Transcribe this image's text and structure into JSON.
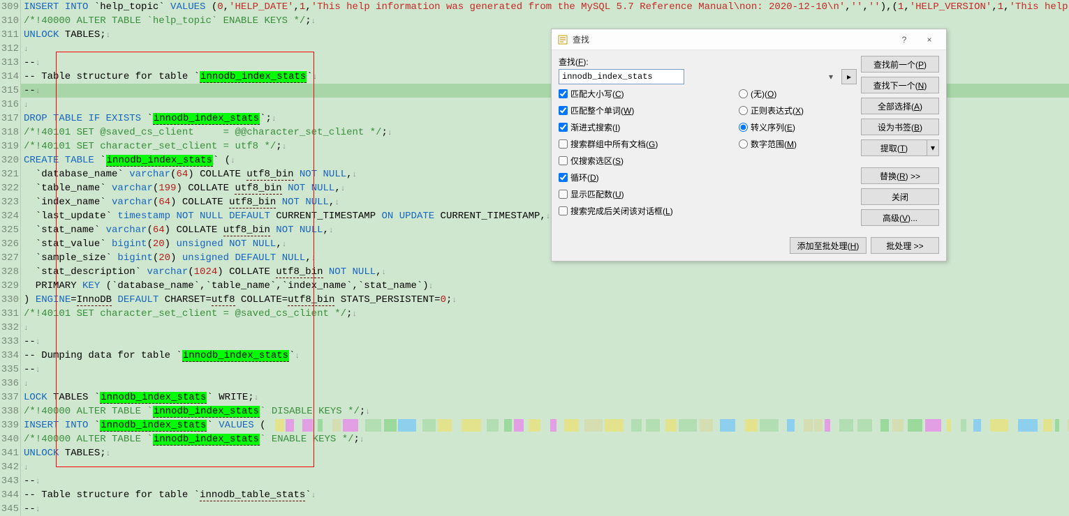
{
  "editor": {
    "highlight_token": "innodb_index_stats",
    "lines": [
      {
        "n": 309,
        "seg": [
          [
            "kw",
            "INSERT "
          ],
          [
            "kw",
            "INTO "
          ],
          [
            "txt",
            "`help_topic` "
          ],
          [
            "kw",
            "VALUES "
          ],
          [
            "txt",
            "("
          ],
          [
            "num",
            "0"
          ],
          [
            "txt",
            ","
          ],
          [
            "st",
            "'HELP_DATE'"
          ],
          [
            "txt",
            ","
          ],
          [
            "num",
            "1"
          ],
          [
            "txt",
            ","
          ],
          [
            "st",
            "'This help information was generated from the MySQL 5.7 Reference Manual\\non: 2020-12-10\\n'"
          ],
          [
            "txt",
            ","
          ],
          [
            "st",
            "''"
          ],
          [
            "txt",
            ","
          ],
          [
            "st",
            "''"
          ],
          [
            "txt",
            "),("
          ],
          [
            "num",
            "1"
          ],
          [
            "txt",
            ","
          ],
          [
            "st",
            "'HELP_VERSION'"
          ],
          [
            "txt",
            ","
          ],
          [
            "num",
            "1"
          ],
          [
            "txt",
            ","
          ],
          [
            "st",
            "'This help"
          ]
        ]
      },
      {
        "n": 310,
        "seg": [
          [
            "cm",
            "/*!40000 ALTER TABLE `help_topic` ENABLE KEYS */"
          ],
          [
            "txt",
            ";"
          ],
          [
            "nl",
            "↓"
          ]
        ]
      },
      {
        "n": 311,
        "seg": [
          [
            "kw",
            "UNLOCK "
          ],
          [
            "txt",
            "TABLES;"
          ],
          [
            "nl",
            "↓"
          ]
        ]
      },
      {
        "n": 312,
        "seg": [
          [
            "nl",
            "↓"
          ]
        ]
      },
      {
        "n": 313,
        "seg": [
          [
            "txt",
            "--"
          ],
          [
            "nl",
            "↓"
          ]
        ]
      },
      {
        "n": 314,
        "seg": [
          [
            "txt",
            "-- Table structure for table `"
          ],
          [
            "hl",
            "innodb_index_stats"
          ],
          [
            "txt",
            "`"
          ],
          [
            "nl",
            "↓"
          ]
        ]
      },
      {
        "n": 315,
        "current": true,
        "seg": [
          [
            "txt",
            "--"
          ],
          [
            "nl",
            "↓"
          ]
        ]
      },
      {
        "n": 316,
        "seg": [
          [
            "nl",
            "↓"
          ]
        ]
      },
      {
        "n": 317,
        "seg": [
          [
            "kw",
            "DROP "
          ],
          [
            "kw",
            "TABLE "
          ],
          [
            "kw",
            "IF "
          ],
          [
            "kw",
            "EXISTS "
          ],
          [
            "txt",
            "`"
          ],
          [
            "hl",
            "innodb_index_stats"
          ],
          [
            "txt",
            "`;"
          ],
          [
            "nl",
            "↓"
          ]
        ]
      },
      {
        "n": 318,
        "seg": [
          [
            "cm",
            "/*!40101 SET @saved_cs_client     = @@character_set_client */"
          ],
          [
            "txt",
            ";"
          ],
          [
            "nl",
            "↓"
          ]
        ]
      },
      {
        "n": 319,
        "seg": [
          [
            "cm",
            "/*!40101 SET character_set_client = "
          ],
          [
            "cm",
            "utf8"
          ],
          [
            "cm",
            " */"
          ],
          [
            "txt",
            ";"
          ],
          [
            "nl",
            "↓"
          ]
        ]
      },
      {
        "n": 320,
        "seg": [
          [
            "kw",
            "CREATE "
          ],
          [
            "kw",
            "TABLE "
          ],
          [
            "txt",
            "`"
          ],
          [
            "hl",
            "innodb_index_stats"
          ],
          [
            "txt",
            "` ("
          ],
          [
            "nl",
            "↓"
          ]
        ]
      },
      {
        "n": 321,
        "seg": [
          [
            "txt",
            "  `database_name` "
          ],
          [
            "kw",
            "varchar"
          ],
          [
            "txt",
            "("
          ],
          [
            "num",
            "64"
          ],
          [
            "txt",
            ") COLLATE "
          ],
          [
            "ul",
            "utf8_bin"
          ],
          [
            "txt",
            " "
          ],
          [
            "kw",
            "NOT "
          ],
          [
            "kw",
            "NULL"
          ],
          [
            "txt",
            ","
          ],
          [
            "nl",
            "↓"
          ]
        ]
      },
      {
        "n": 322,
        "seg": [
          [
            "txt",
            "  `table_name` "
          ],
          [
            "kw",
            "varchar"
          ],
          [
            "txt",
            "("
          ],
          [
            "num",
            "199"
          ],
          [
            "txt",
            ") COLLATE "
          ],
          [
            "ul",
            "utf8_bin"
          ],
          [
            "txt",
            " "
          ],
          [
            "kw",
            "NOT "
          ],
          [
            "kw",
            "NULL"
          ],
          [
            "txt",
            ","
          ],
          [
            "nl",
            "↓"
          ]
        ]
      },
      {
        "n": 323,
        "seg": [
          [
            "txt",
            "  `index_name` "
          ],
          [
            "kw",
            "varchar"
          ],
          [
            "txt",
            "("
          ],
          [
            "num",
            "64"
          ],
          [
            "txt",
            ") COLLATE "
          ],
          [
            "ul",
            "utf8_bin"
          ],
          [
            "txt",
            " "
          ],
          [
            "kw",
            "NOT "
          ],
          [
            "kw",
            "NULL"
          ],
          [
            "txt",
            ","
          ],
          [
            "nl",
            "↓"
          ]
        ]
      },
      {
        "n": 324,
        "seg": [
          [
            "txt",
            "  `last_update` "
          ],
          [
            "kw",
            "timestamp "
          ],
          [
            "kw",
            "NOT "
          ],
          [
            "kw",
            "NULL "
          ],
          [
            "kw",
            "DEFAULT "
          ],
          [
            "txt",
            "CURRENT_TIMESTAMP "
          ],
          [
            "kw",
            "ON "
          ],
          [
            "kw",
            "UPDATE "
          ],
          [
            "txt",
            "CURRENT_TIMESTAMP,"
          ],
          [
            "nl",
            "↓"
          ]
        ]
      },
      {
        "n": 325,
        "seg": [
          [
            "txt",
            "  `stat_name` "
          ],
          [
            "kw",
            "varchar"
          ],
          [
            "txt",
            "("
          ],
          [
            "num",
            "64"
          ],
          [
            "txt",
            ") COLLATE "
          ],
          [
            "ul",
            "utf8_bin"
          ],
          [
            "txt",
            " "
          ],
          [
            "kw",
            "NOT "
          ],
          [
            "kw",
            "NULL"
          ],
          [
            "txt",
            ","
          ],
          [
            "nl",
            "↓"
          ]
        ]
      },
      {
        "n": 326,
        "seg": [
          [
            "txt",
            "  `stat_value` "
          ],
          [
            "kw",
            "bigint"
          ],
          [
            "txt",
            "("
          ],
          [
            "num",
            "20"
          ],
          [
            "txt",
            ") "
          ],
          [
            "kw",
            "unsigned "
          ],
          [
            "kw",
            "NOT "
          ],
          [
            "kw",
            "NULL"
          ],
          [
            "txt",
            ","
          ],
          [
            "nl",
            "↓"
          ]
        ]
      },
      {
        "n": 327,
        "seg": [
          [
            "txt",
            "  `sample_size` "
          ],
          [
            "kw",
            "bigint"
          ],
          [
            "txt",
            "("
          ],
          [
            "num",
            "20"
          ],
          [
            "txt",
            ") "
          ],
          [
            "kw",
            "unsigned "
          ],
          [
            "kw",
            "DEFAULT "
          ],
          [
            "kw",
            "NULL"
          ],
          [
            "txt",
            ","
          ],
          [
            "nl",
            "↓"
          ]
        ]
      },
      {
        "n": 328,
        "seg": [
          [
            "txt",
            "  `stat_description` "
          ],
          [
            "kw",
            "varchar"
          ],
          [
            "txt",
            "("
          ],
          [
            "num",
            "1024"
          ],
          [
            "txt",
            ") COLLATE "
          ],
          [
            "ul",
            "utf8_bin"
          ],
          [
            "txt",
            " "
          ],
          [
            "kw",
            "NOT "
          ],
          [
            "kw",
            "NULL"
          ],
          [
            "txt",
            ","
          ],
          [
            "nl",
            "↓"
          ]
        ]
      },
      {
        "n": 329,
        "seg": [
          [
            "txt",
            "  PRIMARY "
          ],
          [
            "kw",
            "KEY "
          ],
          [
            "txt",
            "(`database_name`,`table_name`,`index_name`,`stat_name`)"
          ],
          [
            "nl",
            "↓"
          ]
        ]
      },
      {
        "n": 330,
        "seg": [
          [
            "txt",
            ") "
          ],
          [
            "kw",
            "ENGINE"
          ],
          [
            "txt",
            "="
          ],
          [
            "ul",
            "InnoDB"
          ],
          [
            "txt",
            " "
          ],
          [
            "kw",
            "DEFAULT "
          ],
          [
            "txt",
            "CHARSET="
          ],
          [
            "ul",
            "utf8"
          ],
          [
            "txt",
            " COLLATE="
          ],
          [
            "ul",
            "utf8_bin"
          ],
          [
            "txt",
            " STATS_PERSISTENT="
          ],
          [
            "num",
            "0"
          ],
          [
            "txt",
            ";"
          ],
          [
            "nl",
            "↓"
          ]
        ]
      },
      {
        "n": 331,
        "seg": [
          [
            "cm",
            "/*!40101 SET character_set_client = @saved_cs_client */"
          ],
          [
            "txt",
            ";"
          ],
          [
            "nl",
            "↓"
          ]
        ]
      },
      {
        "n": 332,
        "seg": [
          [
            "nl",
            "↓"
          ]
        ]
      },
      {
        "n": 333,
        "seg": [
          [
            "txt",
            "--"
          ],
          [
            "nl",
            "↓"
          ]
        ]
      },
      {
        "n": 334,
        "seg": [
          [
            "txt",
            "-- Dumping data for table `"
          ],
          [
            "hl",
            "innodb_index_stats"
          ],
          [
            "txt",
            "`"
          ],
          [
            "nl",
            "↓"
          ]
        ]
      },
      {
        "n": 335,
        "seg": [
          [
            "txt",
            "--"
          ],
          [
            "nl",
            "↓"
          ]
        ]
      },
      {
        "n": 336,
        "seg": [
          [
            "nl",
            "↓"
          ]
        ]
      },
      {
        "n": 337,
        "seg": [
          [
            "kw",
            "LOCK "
          ],
          [
            "txt",
            "TABLES `"
          ],
          [
            "hl",
            "innodb_index_stats"
          ],
          [
            "txt",
            "` WRITE;"
          ],
          [
            "nl",
            "↓"
          ]
        ]
      },
      {
        "n": 338,
        "seg": [
          [
            "cm",
            "/*!40000 ALTER TABLE `"
          ],
          [
            "hl",
            "innodb_index_stats"
          ],
          [
            "cm",
            "` DISABLE KEYS */"
          ],
          [
            "txt",
            ";"
          ],
          [
            "nl",
            "↓"
          ]
        ]
      },
      {
        "n": 339,
        "seg": [
          [
            "kw",
            "INSERT "
          ],
          [
            "kw",
            "INTO "
          ],
          [
            "txt",
            "`"
          ],
          [
            "hl",
            "innodb_index_stats"
          ],
          [
            "txt",
            "` "
          ],
          [
            "kw",
            "VALUES "
          ],
          [
            "txt",
            "("
          ]
        ]
      },
      {
        "n": 340,
        "seg": [
          [
            "cm",
            "/*!40000 ALTER TABLE `"
          ],
          [
            "hl",
            "innodb_index_stats"
          ],
          [
            "cm",
            "` ENABLE KEYS */"
          ],
          [
            "txt",
            ";"
          ],
          [
            "nl",
            "↓"
          ]
        ]
      },
      {
        "n": 341,
        "seg": [
          [
            "kw",
            "UNLOCK "
          ],
          [
            "txt",
            "TABLES;"
          ],
          [
            "nl",
            "↓"
          ]
        ]
      },
      {
        "n": 342,
        "seg": [
          [
            "nl",
            "↓"
          ]
        ]
      },
      {
        "n": 343,
        "seg": [
          [
            "txt",
            "--"
          ],
          [
            "nl",
            "↓"
          ]
        ]
      },
      {
        "n": 344,
        "seg": [
          [
            "txt",
            "-- Table structure for table `"
          ],
          [
            "ul",
            "innodb_table_stats"
          ],
          [
            "txt",
            "`"
          ],
          [
            "nl",
            "↓"
          ]
        ]
      },
      {
        "n": 345,
        "seg": [
          [
            "txt",
            "--"
          ],
          [
            "nl",
            "↓"
          ]
        ]
      }
    ]
  },
  "dialog": {
    "title": "查找",
    "help_glyph": "?",
    "close_glyph": "×",
    "label_find": "查找(F):",
    "search_value": "innodb_index_stats",
    "btn_arrow": "▸",
    "checks_left": [
      {
        "label": "匹配大小写(C)",
        "checked": true
      },
      {
        "label": "匹配整个单词(W)",
        "checked": true
      },
      {
        "label": "渐进式搜索(I)",
        "checked": true
      },
      {
        "label": "搜索群组中所有文档(G)",
        "checked": false
      },
      {
        "label": "仅搜索选区(S)",
        "checked": false
      },
      {
        "label": "循环(D)",
        "checked": true
      },
      {
        "label": "显示匹配数(U)",
        "checked": false
      },
      {
        "label": "搜索完成后关闭该对话框(L)",
        "checked": false
      }
    ],
    "radios": [
      {
        "label": "(无)(O)",
        "checked": false
      },
      {
        "label": "正则表达式(X)",
        "checked": false
      },
      {
        "label": "转义序列(E)",
        "checked": true
      },
      {
        "label": "数字范围(M)",
        "checked": false
      }
    ],
    "buttons": {
      "find_prev": "查找前一个(P)",
      "find_next": "查找下一个(N)",
      "select_all": "全部选择(A)",
      "bookmark": "设为书签(B)",
      "extract": "提取(T)",
      "extract_arrow": "▾",
      "replace": "替换(R) >>",
      "close": "关闭",
      "advanced": "高级(V)...",
      "add_batch": "添加至批处理(H)",
      "batch": "批处理 >>"
    }
  },
  "minimap_colors": [
    "#d8d8a0",
    "#7ad07a",
    "#60c0ff",
    "#f070f0",
    "#f0e060",
    "#a0d8a0"
  ]
}
